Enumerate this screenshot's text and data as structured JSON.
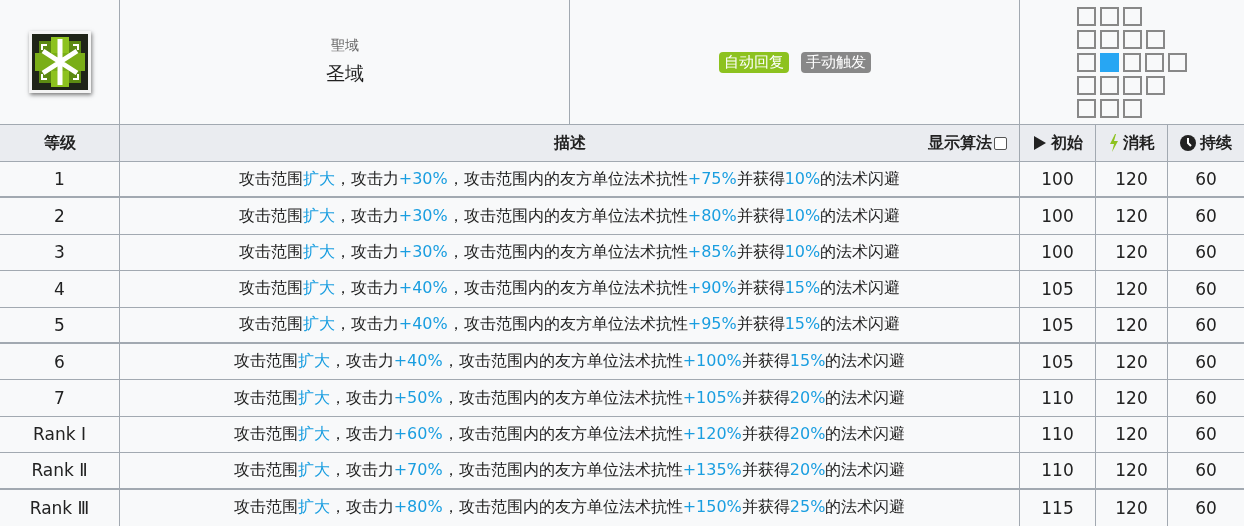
{
  "skill": {
    "name_original": "聖域",
    "name": "圣域",
    "tags": [
      {
        "label": "自动回复",
        "color": "#8dc21f"
      },
      {
        "label": "手动触发",
        "color": "#888888"
      }
    ],
    "range": [
      [
        {
          "selected": false
        },
        {
          "selected": false
        },
        {
          "selected": false
        }
      ],
      [
        {
          "selected": false
        },
        {
          "selected": false
        },
        {
          "selected": false
        },
        {
          "selected": false
        }
      ],
      [
        {
          "selected": false
        },
        {
          "selected": true
        },
        {
          "selected": false
        },
        {
          "selected": false
        },
        {
          "selected": false
        }
      ],
      [
        {
          "selected": false
        },
        {
          "selected": false
        },
        {
          "selected": false
        },
        {
          "selected": false
        }
      ],
      [
        {
          "selected": false
        },
        {
          "selected": false
        },
        {
          "selected": false
        }
      ]
    ]
  },
  "table": {
    "columns": {
      "level": "等级",
      "description": "描述",
      "show_formula": {
        "label": "显示算法",
        "checked": false
      },
      "initial": "初始",
      "cost": "消耗",
      "duration": "持续"
    },
    "rows": [
      {
        "level": "1",
        "separator_below": true,
        "description": [
          {
            "text": "攻击范围",
            "highlight": false
          },
          {
            "text": "扩大",
            "highlight": true
          },
          {
            "text": "，攻击力",
            "highlight": false
          },
          {
            "text": "+30%",
            "highlight": true
          },
          {
            "text": "，攻击范围内的友方单位法术抗性",
            "highlight": false
          },
          {
            "text": "+75%",
            "highlight": true
          },
          {
            "text": "并获得",
            "highlight": false
          },
          {
            "text": "10%",
            "highlight": true
          },
          {
            "text": "的法术闪避",
            "highlight": false
          }
        ],
        "initial": "100",
        "cost": "120",
        "duration": "60"
      },
      {
        "level": "2",
        "separator_below": false,
        "description": [
          {
            "text": "攻击范围",
            "highlight": false
          },
          {
            "text": "扩大",
            "highlight": true
          },
          {
            "text": "，攻击力",
            "highlight": false
          },
          {
            "text": "+30%",
            "highlight": true
          },
          {
            "text": "，攻击范围内的友方单位法术抗性",
            "highlight": false
          },
          {
            "text": "+80%",
            "highlight": true
          },
          {
            "text": "并获得",
            "highlight": false
          },
          {
            "text": "10%",
            "highlight": true
          },
          {
            "text": "的法术闪避",
            "highlight": false
          }
        ],
        "initial": "100",
        "cost": "120",
        "duration": "60"
      },
      {
        "level": "3",
        "separator_below": false,
        "description": [
          {
            "text": "攻击范围",
            "highlight": false
          },
          {
            "text": "扩大",
            "highlight": true
          },
          {
            "text": "，攻击力",
            "highlight": false
          },
          {
            "text": "+30%",
            "highlight": true
          },
          {
            "text": "，攻击范围内的友方单位法术抗性",
            "highlight": false
          },
          {
            "text": "+85%",
            "highlight": true
          },
          {
            "text": "并获得",
            "highlight": false
          },
          {
            "text": "10%",
            "highlight": true
          },
          {
            "text": "的法术闪避",
            "highlight": false
          }
        ],
        "initial": "100",
        "cost": "120",
        "duration": "60"
      },
      {
        "level": "4",
        "separator_below": false,
        "description": [
          {
            "text": "攻击范围",
            "highlight": false
          },
          {
            "text": "扩大",
            "highlight": true
          },
          {
            "text": "，攻击力",
            "highlight": false
          },
          {
            "text": "+40%",
            "highlight": true
          },
          {
            "text": "，攻击范围内的友方单位法术抗性",
            "highlight": false
          },
          {
            "text": "+90%",
            "highlight": true
          },
          {
            "text": "并获得",
            "highlight": false
          },
          {
            "text": "15%",
            "highlight": true
          },
          {
            "text": "的法术闪避",
            "highlight": false
          }
        ],
        "initial": "105",
        "cost": "120",
        "duration": "60"
      },
      {
        "level": "5",
        "separator_below": true,
        "description": [
          {
            "text": "攻击范围",
            "highlight": false
          },
          {
            "text": "扩大",
            "highlight": true
          },
          {
            "text": "，攻击力",
            "highlight": false
          },
          {
            "text": "+40%",
            "highlight": true
          },
          {
            "text": "，攻击范围内的友方单位法术抗性",
            "highlight": false
          },
          {
            "text": "+95%",
            "highlight": true
          },
          {
            "text": "并获得",
            "highlight": false
          },
          {
            "text": "15%",
            "highlight": true
          },
          {
            "text": "的法术闪避",
            "highlight": false
          }
        ],
        "initial": "105",
        "cost": "120",
        "duration": "60"
      },
      {
        "level": "6",
        "separator_below": false,
        "description": [
          {
            "text": "攻击范围",
            "highlight": false
          },
          {
            "text": "扩大",
            "highlight": true
          },
          {
            "text": "，攻击力",
            "highlight": false
          },
          {
            "text": "+40%",
            "highlight": true
          },
          {
            "text": "，攻击范围内的友方单位法术抗性",
            "highlight": false
          },
          {
            "text": "+100%",
            "highlight": true
          },
          {
            "text": "并获得",
            "highlight": false
          },
          {
            "text": "15%",
            "highlight": true
          },
          {
            "text": "的法术闪避",
            "highlight": false
          }
        ],
        "initial": "105",
        "cost": "120",
        "duration": "60"
      },
      {
        "level": "7",
        "separator_below": false,
        "description": [
          {
            "text": "攻击范围",
            "highlight": false
          },
          {
            "text": "扩大",
            "highlight": true
          },
          {
            "text": "，攻击力",
            "highlight": false
          },
          {
            "text": "+50%",
            "highlight": true
          },
          {
            "text": "，攻击范围内的友方单位法术抗性",
            "highlight": false
          },
          {
            "text": "+105%",
            "highlight": true
          },
          {
            "text": "并获得",
            "highlight": false
          },
          {
            "text": "20%",
            "highlight": true
          },
          {
            "text": "的法术闪避",
            "highlight": false
          }
        ],
        "initial": "110",
        "cost": "120",
        "duration": "60"
      },
      {
        "level": "Rank Ⅰ",
        "separator_below": false,
        "description": [
          {
            "text": "攻击范围",
            "highlight": false
          },
          {
            "text": "扩大",
            "highlight": true
          },
          {
            "text": "，攻击力",
            "highlight": false
          },
          {
            "text": "+60%",
            "highlight": true
          },
          {
            "text": "，攻击范围内的友方单位法术抗性",
            "highlight": false
          },
          {
            "text": "+120%",
            "highlight": true
          },
          {
            "text": "并获得",
            "highlight": false
          },
          {
            "text": "20%",
            "highlight": true
          },
          {
            "text": "的法术闪避",
            "highlight": false
          }
        ],
        "initial": "110",
        "cost": "120",
        "duration": "60"
      },
      {
        "level": "Rank Ⅱ",
        "separator_below": true,
        "description": [
          {
            "text": "攻击范围",
            "highlight": false
          },
          {
            "text": "扩大",
            "highlight": true
          },
          {
            "text": "，攻击力",
            "highlight": false
          },
          {
            "text": "+70%",
            "highlight": true
          },
          {
            "text": "，攻击范围内的友方单位法术抗性",
            "highlight": false
          },
          {
            "text": "+135%",
            "highlight": true
          },
          {
            "text": "并获得",
            "highlight": false
          },
          {
            "text": "20%",
            "highlight": true
          },
          {
            "text": "的法术闪避",
            "highlight": false
          }
        ],
        "initial": "110",
        "cost": "120",
        "duration": "60"
      },
      {
        "level": "Rank Ⅲ",
        "separator_below": false,
        "description": [
          {
            "text": "攻击范围",
            "highlight": false
          },
          {
            "text": "扩大",
            "highlight": true
          },
          {
            "text": "，攻击力",
            "highlight": false
          },
          {
            "text": "+80%",
            "highlight": true
          },
          {
            "text": "，攻击范围内的友方单位法术抗性",
            "highlight": false
          },
          {
            "text": "+150%",
            "highlight": true
          },
          {
            "text": "并获得",
            "highlight": false
          },
          {
            "text": "25%",
            "highlight": true
          },
          {
            "text": "的法术闪避",
            "highlight": false
          }
        ],
        "initial": "115",
        "cost": "120",
        "duration": "60"
      }
    ]
  }
}
